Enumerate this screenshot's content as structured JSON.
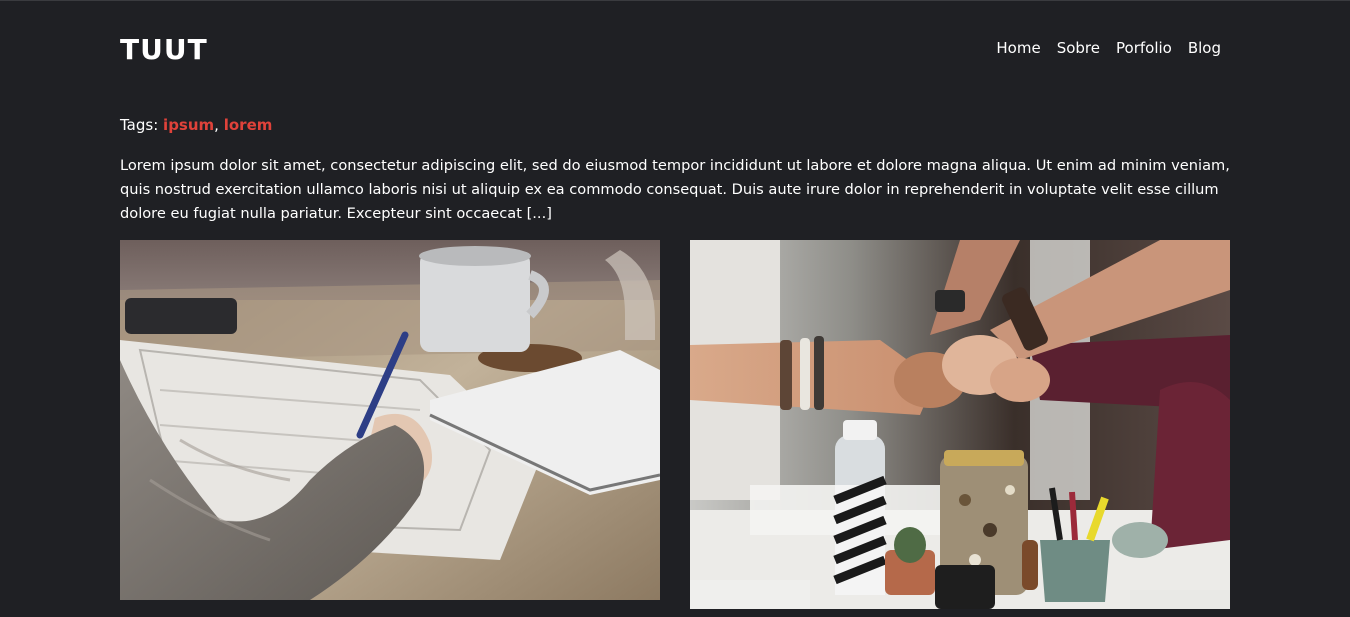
{
  "header": {
    "logo": "TUUT",
    "nav": [
      {
        "label": "Home"
      },
      {
        "label": "Sobre"
      },
      {
        "label": "Porfolio"
      },
      {
        "label": "Blog"
      }
    ]
  },
  "post": {
    "tags_label": "Tags:",
    "tags": [
      "ipsum",
      "lorem"
    ],
    "tag_separator": ",",
    "excerpt": "Lorem ipsum dolor sit amet, consectetur adipiscing elit, sed do eiusmod tempor incididunt ut labore et dolore magna aliqua. Ut enim ad minim veniam, quis nostrud exercitation ullamco laboris nisi ut aliquip ex ea commodo consequat. Duis aute irure dolor in reprehenderit in voluptate velit esse cillum dolore eu fugiat nulla pariatur. Excepteur sint occaecat [...]",
    "images": [
      {
        "subject": "writing-at-desk-photo"
      },
      {
        "subject": "team-fist-bump-photo"
      }
    ]
  },
  "colors": {
    "background": "#1f2024",
    "text": "#ffffff",
    "tag_accent": "#e0423a"
  }
}
